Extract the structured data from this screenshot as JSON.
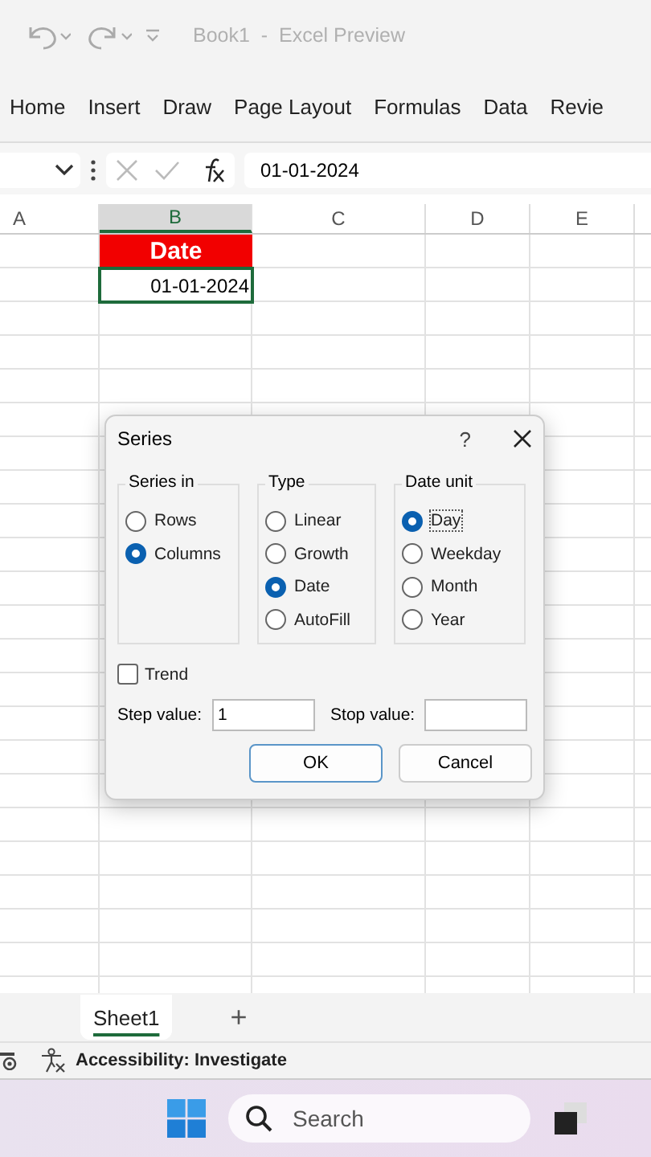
{
  "window": {
    "title": "Book1  -  Excel Preview"
  },
  "ribbon_tabs": [
    "Home",
    "Insert",
    "Draw",
    "Page Layout",
    "Formulas",
    "Data",
    "Revie"
  ],
  "formula_bar": {
    "value": "01-01-2024"
  },
  "columns": [
    {
      "label": "A",
      "selected": false
    },
    {
      "label": "B",
      "selected": true
    },
    {
      "label": "C",
      "selected": false
    },
    {
      "label": "D",
      "selected": false
    },
    {
      "label": "E",
      "selected": false
    }
  ],
  "cells": [
    {
      "kind": "header",
      "text": "Date",
      "selected": false
    },
    {
      "kind": "value",
      "text": "01-01-2024",
      "selected": true
    }
  ],
  "dialog": {
    "title": "Series",
    "help": "?",
    "groups": [
      {
        "title": "Series in",
        "options": [
          {
            "label": "Rows",
            "selected": false
          },
          {
            "label": "Columns",
            "selected": true
          }
        ]
      },
      {
        "title": "Type",
        "options": [
          {
            "label": "Linear",
            "selected": false
          },
          {
            "label": "Growth",
            "selected": false
          },
          {
            "label": "Date",
            "selected": true
          },
          {
            "label": "AutoFill",
            "selected": false
          }
        ]
      },
      {
        "title": "Date unit",
        "options": [
          {
            "label": "Day",
            "selected": true
          },
          {
            "label": "Weekday",
            "selected": false
          },
          {
            "label": "Month",
            "selected": false
          },
          {
            "label": "Year",
            "selected": false
          }
        ]
      }
    ],
    "trend": {
      "label": "Trend",
      "checked": false
    },
    "step": {
      "label": "Step value:",
      "value": "1"
    },
    "stop": {
      "label": "Stop value:"
    },
    "buttons": [
      {
        "label": "OK",
        "kind": "default"
      },
      {
        "label": "Cancel",
        "kind": "normal"
      }
    ]
  },
  "sheet_tabs": [
    {
      "label": "Sheet1",
      "selected": true
    }
  ],
  "add_sheet": "+",
  "status_bar": {
    "text": "Accessibility: Investigate"
  },
  "taskbar": {
    "search_placeholder": "Search"
  }
}
